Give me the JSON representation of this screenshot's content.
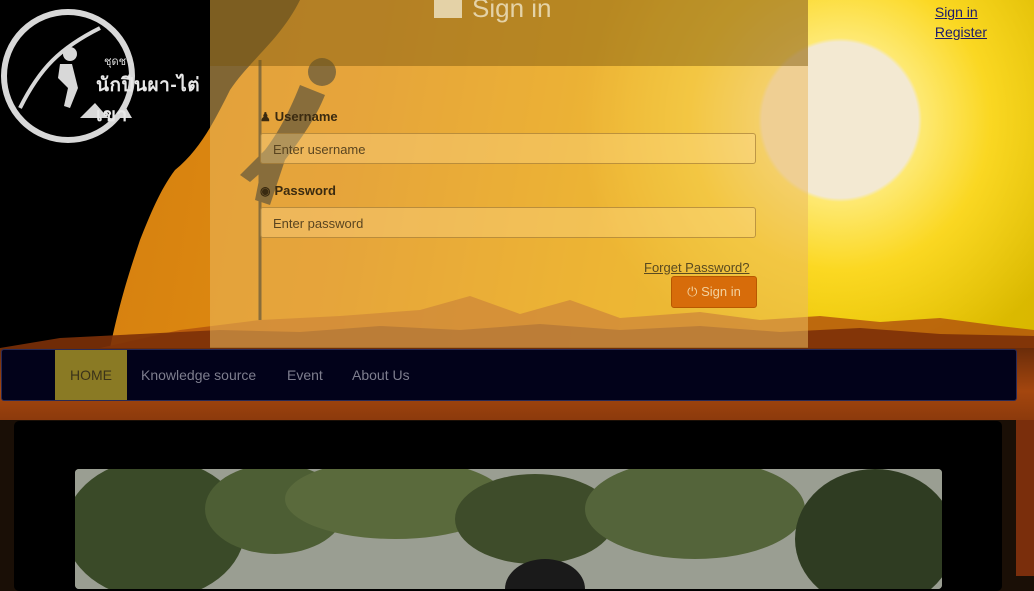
{
  "auth_links": {
    "sign_in": "Sign in",
    "register": "Register"
  },
  "logo": {
    "line1": "ชุดชน",
    "line2": "นักปีนผา-ไต่เขา"
  },
  "signin": {
    "title": "Sign in",
    "username_label": "Username",
    "username_placeholder": "Enter username",
    "password_label": "Password",
    "password_placeholder": "Enter password",
    "forget_link": "Forget Password?",
    "submit_label": "Sign in",
    "submit_icon": "power-icon",
    "user_icon": "user-icon",
    "eye_icon": "eye-icon"
  },
  "nav": {
    "items": [
      {
        "label": "HOME",
        "active": true
      },
      {
        "label": "Knowledge source",
        "active": false
      },
      {
        "label": "Event",
        "active": false
      },
      {
        "label": "About Us",
        "active": false
      }
    ]
  },
  "colors": {
    "nav_bg": "#02021a",
    "active_bg": "#8a7a24",
    "button": "#d76c0a"
  }
}
